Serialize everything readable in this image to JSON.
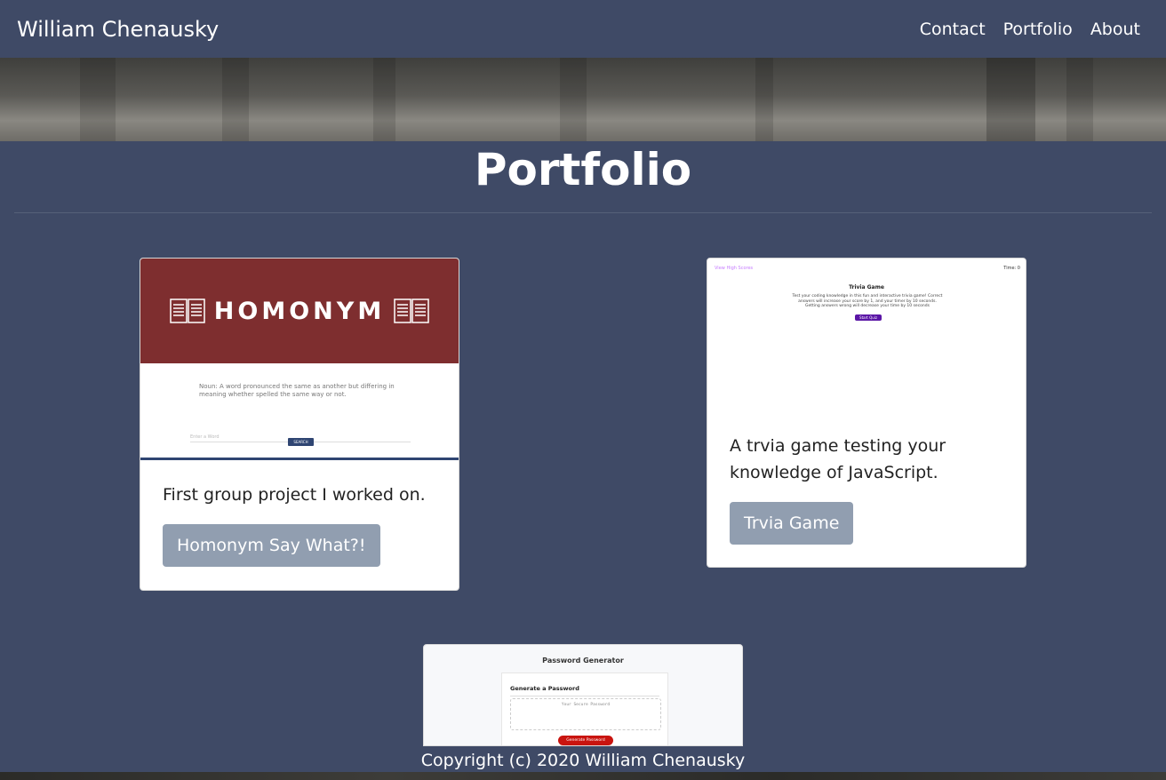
{
  "nav": {
    "brand": "William Chenausky",
    "links": [
      "Contact",
      "Portfolio",
      "About"
    ]
  },
  "page": {
    "title": "Portfolio"
  },
  "projects": [
    {
      "preview": {
        "logo_text": "HOMONYM",
        "definition": "Noun: A word pronounced the same as another but differing in meaning whether spelled the same way or not.",
        "field_placeholder": "Enter a Word",
        "search_label": "SEARCH"
      },
      "description": "First group project I worked on.",
      "button_label": "Homonym Say What?!"
    },
    {
      "preview": {
        "highscores_link": "View High Scores",
        "time": "Time: 0",
        "title": "Trivia Game",
        "description": "Test your coding knowledge in this fun and interactive trivia game! Correct answers will increase your score by 1, and your timer by 10 seconds. Getting answers wrong will decrease your time by 10 seconds",
        "start_label": "Start Quiz"
      },
      "description": "A trvia game testing your knowledge of JavaScript.",
      "button_label": "Trvia Game"
    },
    {
      "preview": {
        "title": "Password Generator",
        "subtitle": "Generate a Password",
        "placeholder": "Your Secure Password",
        "button_label": "Generate Password"
      }
    }
  ],
  "footer": {
    "text": "Copyright (c) 2020 William Chenausky"
  },
  "colors": {
    "background": "#3f4a66",
    "button": "#919eb0",
    "homonym_red": "#7e2e2f"
  }
}
